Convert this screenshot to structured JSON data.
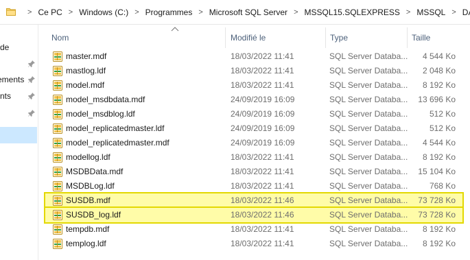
{
  "address_bar": {
    "breadcrumbs": [
      "Ce PC",
      "Windows (C:)",
      "Programmes",
      "Microsoft SQL Server",
      "MSSQL15.SQLEXPRESS",
      "MSSQL",
      "DATA"
    ],
    "separator": ">"
  },
  "nav_pane": {
    "items": [
      {
        "label": "de",
        "pinned": false
      },
      {
        "label": "",
        "pinned": true
      },
      {
        "label": "ements",
        "pinned": true
      },
      {
        "label": "nts",
        "pinned": true
      },
      {
        "label": "",
        "pinned": true
      }
    ]
  },
  "columns": {
    "name": "Nom",
    "modified": "Modifié le",
    "type": "Type",
    "size": "Taille"
  },
  "files": [
    {
      "name": "master.mdf",
      "modified": "18/03/2022 11:41",
      "type": "SQL Server Databa...",
      "size": "4 544 Ko",
      "highlighted": false
    },
    {
      "name": "mastlog.ldf",
      "modified": "18/03/2022 11:41",
      "type": "SQL Server Databa...",
      "size": "2 048 Ko",
      "highlighted": false
    },
    {
      "name": "model.mdf",
      "modified": "18/03/2022 11:41",
      "type": "SQL Server Databa...",
      "size": "8 192 Ko",
      "highlighted": false
    },
    {
      "name": "model_msdbdata.mdf",
      "modified": "24/09/2019 16:09",
      "type": "SQL Server Databa...",
      "size": "13 696 Ko",
      "highlighted": false
    },
    {
      "name": "model_msdblog.ldf",
      "modified": "24/09/2019 16:09",
      "type": "SQL Server Databa...",
      "size": "512 Ko",
      "highlighted": false
    },
    {
      "name": "model_replicatedmaster.ldf",
      "modified": "24/09/2019 16:09",
      "type": "SQL Server Databa...",
      "size": "512 Ko",
      "highlighted": false
    },
    {
      "name": "model_replicatedmaster.mdf",
      "modified": "24/09/2019 16:09",
      "type": "SQL Server Databa...",
      "size": "4 544 Ko",
      "highlighted": false
    },
    {
      "name": "modellog.ldf",
      "modified": "18/03/2022 11:41",
      "type": "SQL Server Databa...",
      "size": "8 192 Ko",
      "highlighted": false
    },
    {
      "name": "MSDBData.mdf",
      "modified": "18/03/2022 11:41",
      "type": "SQL Server Databa...",
      "size": "15 104 Ko",
      "highlighted": false
    },
    {
      "name": "MSDBLog.ldf",
      "modified": "18/03/2022 11:41",
      "type": "SQL Server Databa...",
      "size": "768 Ko",
      "highlighted": false
    },
    {
      "name": "SUSDB.mdf",
      "modified": "18/03/2022 11:46",
      "type": "SQL Server Databa...",
      "size": "73 728 Ko",
      "highlighted": true
    },
    {
      "name": "SUSDB_log.ldf",
      "modified": "18/03/2022 11:46",
      "type": "SQL Server Databa...",
      "size": "73 728 Ko",
      "highlighted": true
    },
    {
      "name": "tempdb.mdf",
      "modified": "18/03/2022 11:41",
      "type": "SQL Server Databa...",
      "size": "8 192 Ko",
      "highlighted": false
    },
    {
      "name": "templog.ldf",
      "modified": "18/03/2022 11:41",
      "type": "SQL Server Databa...",
      "size": "8 192 Ko",
      "highlighted": false
    }
  ],
  "icons": {
    "address_folder": "folder-icon",
    "file": "sql-database-file-icon",
    "pin": "pin-icon",
    "sort": "sort-ascending-icon"
  },
  "colors": {
    "highlight_fill": "#fffca8",
    "highlight_border": "#e3d800",
    "nav_selected": "#cce8ff"
  }
}
